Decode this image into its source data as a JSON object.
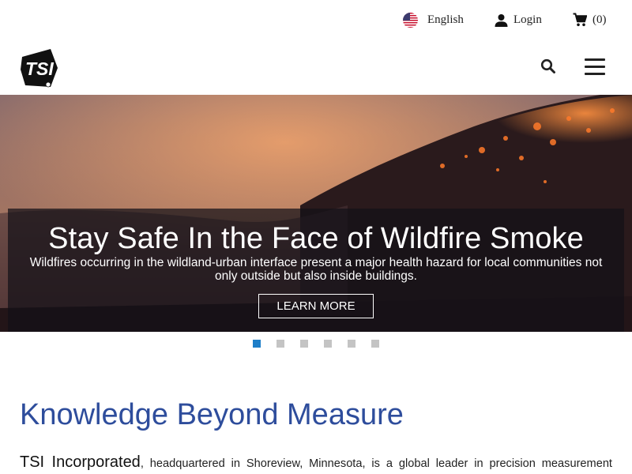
{
  "utility": {
    "language": "English",
    "login": "Login",
    "cart_count": "(0)"
  },
  "icons": {
    "flag": "us-flag-icon",
    "login": "person-icon",
    "cart": "cart-icon",
    "search": "search-icon",
    "menu": "hamburger-menu-icon"
  },
  "logo_text": "TSI",
  "hero": {
    "title": "Stay Safe In the Face of Wildfire Smoke",
    "text": "Wildfires occurring in the wildland-urban interface present a major health hazard for local communities not only outside but also inside buildings.",
    "button": "LEARN MORE"
  },
  "carousel": {
    "slides": 6,
    "active_index": 0
  },
  "main": {
    "title": "Knowledge Beyond Measure",
    "company": "TSI Incorporated",
    "intro_rest": ", headquartered in Shoreview, Minnesota, is a global leader in precision measurement"
  },
  "colors": {
    "heading": "#2e4d9c",
    "dot_active": "#1e7ec8",
    "dot_inactive": "#c4c4c4"
  }
}
